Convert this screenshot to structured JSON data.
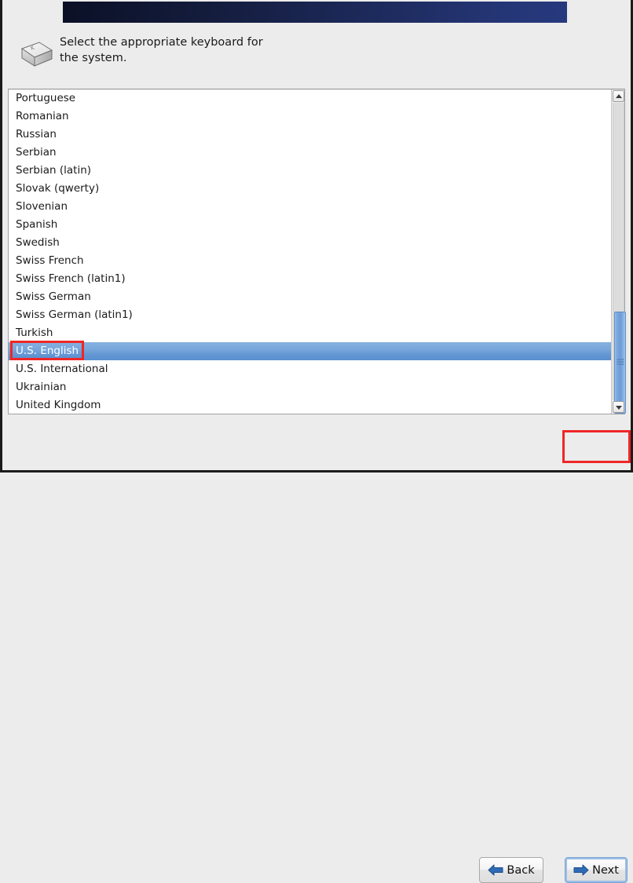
{
  "window": {
    "title": "",
    "background_color": "#ececec",
    "banner_color": "#1d2a5c"
  },
  "instruction": {
    "icon": "keyboard-key-icon",
    "text": "Select the appropriate keyboard for\nthe system."
  },
  "keyboard_list": {
    "items": [
      {
        "label": "Portuguese",
        "selected": false
      },
      {
        "label": "Romanian",
        "selected": false
      },
      {
        "label": "Russian",
        "selected": false
      },
      {
        "label": "Serbian",
        "selected": false
      },
      {
        "label": "Serbian (latin)",
        "selected": false
      },
      {
        "label": "Slovak (qwerty)",
        "selected": false
      },
      {
        "label": "Slovenian",
        "selected": false
      },
      {
        "label": "Spanish",
        "selected": false
      },
      {
        "label": "Swedish",
        "selected": false
      },
      {
        "label": "Swiss French",
        "selected": false
      },
      {
        "label": "Swiss French (latin1)",
        "selected": false
      },
      {
        "label": "Swiss German",
        "selected": false
      },
      {
        "label": "Swiss German (latin1)",
        "selected": false
      },
      {
        "label": "Turkish",
        "selected": false
      },
      {
        "label": "U.S. English",
        "selected": true
      },
      {
        "label": "U.S. International",
        "selected": false
      },
      {
        "label": "Ukrainian",
        "selected": false
      },
      {
        "label": "United Kingdom",
        "selected": false
      }
    ],
    "selected_value": "U.S. English",
    "selection_color": "#6094d2"
  },
  "scrollbar": {
    "up_arrow": "chevron-up-icon",
    "down_arrow": "chevron-down-icon",
    "thumb_color": "#7fa9dd",
    "thumb_position_percent": 72
  },
  "footer": {
    "back_label": "Back",
    "back_icon": "arrow-left-icon",
    "next_label": "Next",
    "next_icon": "arrow-right-icon",
    "next_focused": true
  },
  "annotations": {
    "highlight_color": "#ef2626",
    "targets": [
      "U.S. English",
      "Next"
    ]
  }
}
